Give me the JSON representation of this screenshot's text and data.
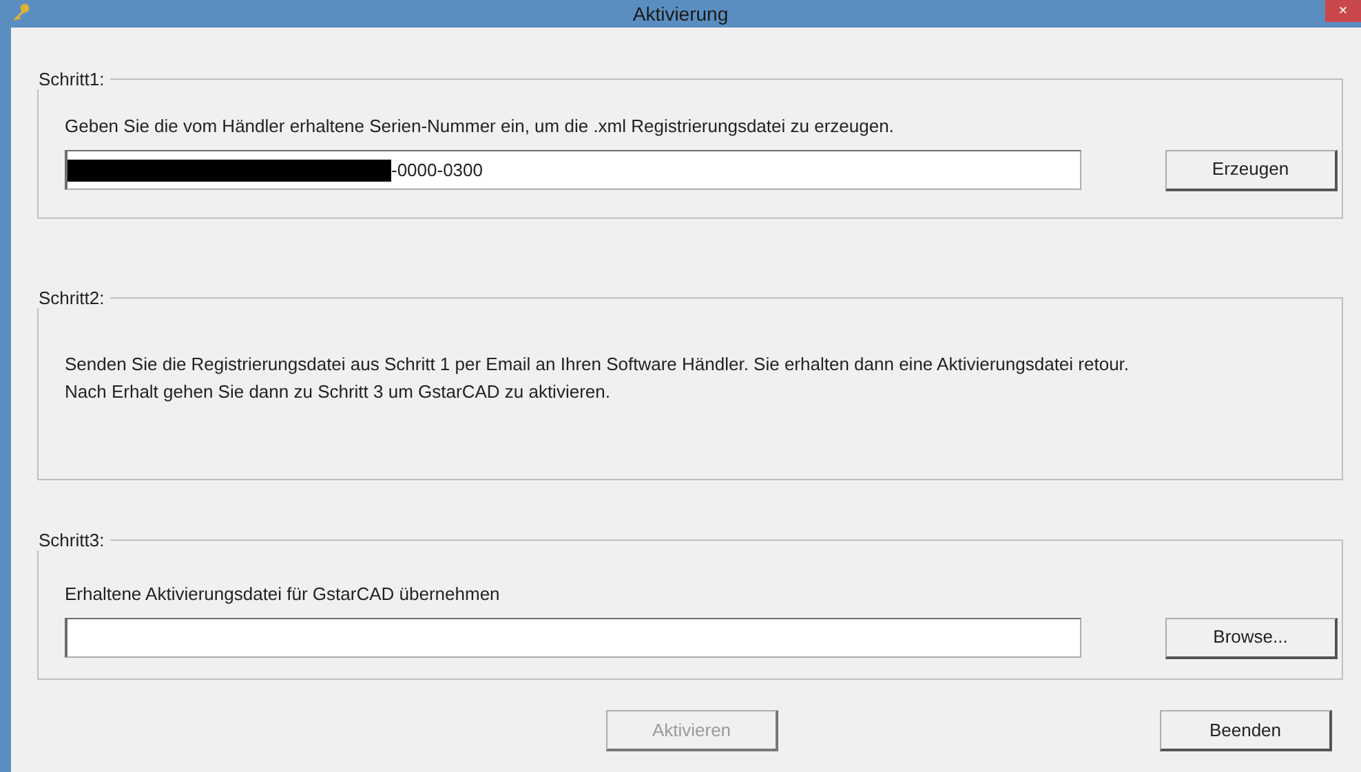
{
  "window": {
    "title": "Aktivierung",
    "close_glyph": "×"
  },
  "steps": [
    {
      "legend": "Schritt1:",
      "lines": [
        "Geben Sie die vom Händler erhaltene Serien-Nummer ein, um die .xml Registrierungsdatei zu erzeugen."
      ],
      "field": {
        "value": "-0000-0300",
        "redacted": true
      },
      "button": {
        "label": "Erzeugen",
        "disabled": false
      }
    },
    {
      "legend": "Schritt2:",
      "lines": [
        "Senden Sie die Registrierungsdatei aus Schritt 1 per Email an Ihren Software Händler. Sie erhalten dann eine Aktivierungsdatei retour.",
        "Nach Erhalt gehen Sie dann zu Schritt 3 um GstarCAD zu aktivieren."
      ]
    },
    {
      "legend": "Schritt3:",
      "lines": [
        "Erhaltene Aktivierungsdatei für GstarCAD übernehmen"
      ],
      "field": {
        "redacted": false
      },
      "button": {
        "label": "Browse...",
        "disabled": false
      }
    }
  ],
  "footer_buttons": [
    {
      "label": "Aktivieren",
      "disabled": true
    },
    {
      "label": "Beenden",
      "disabled": false
    }
  ]
}
